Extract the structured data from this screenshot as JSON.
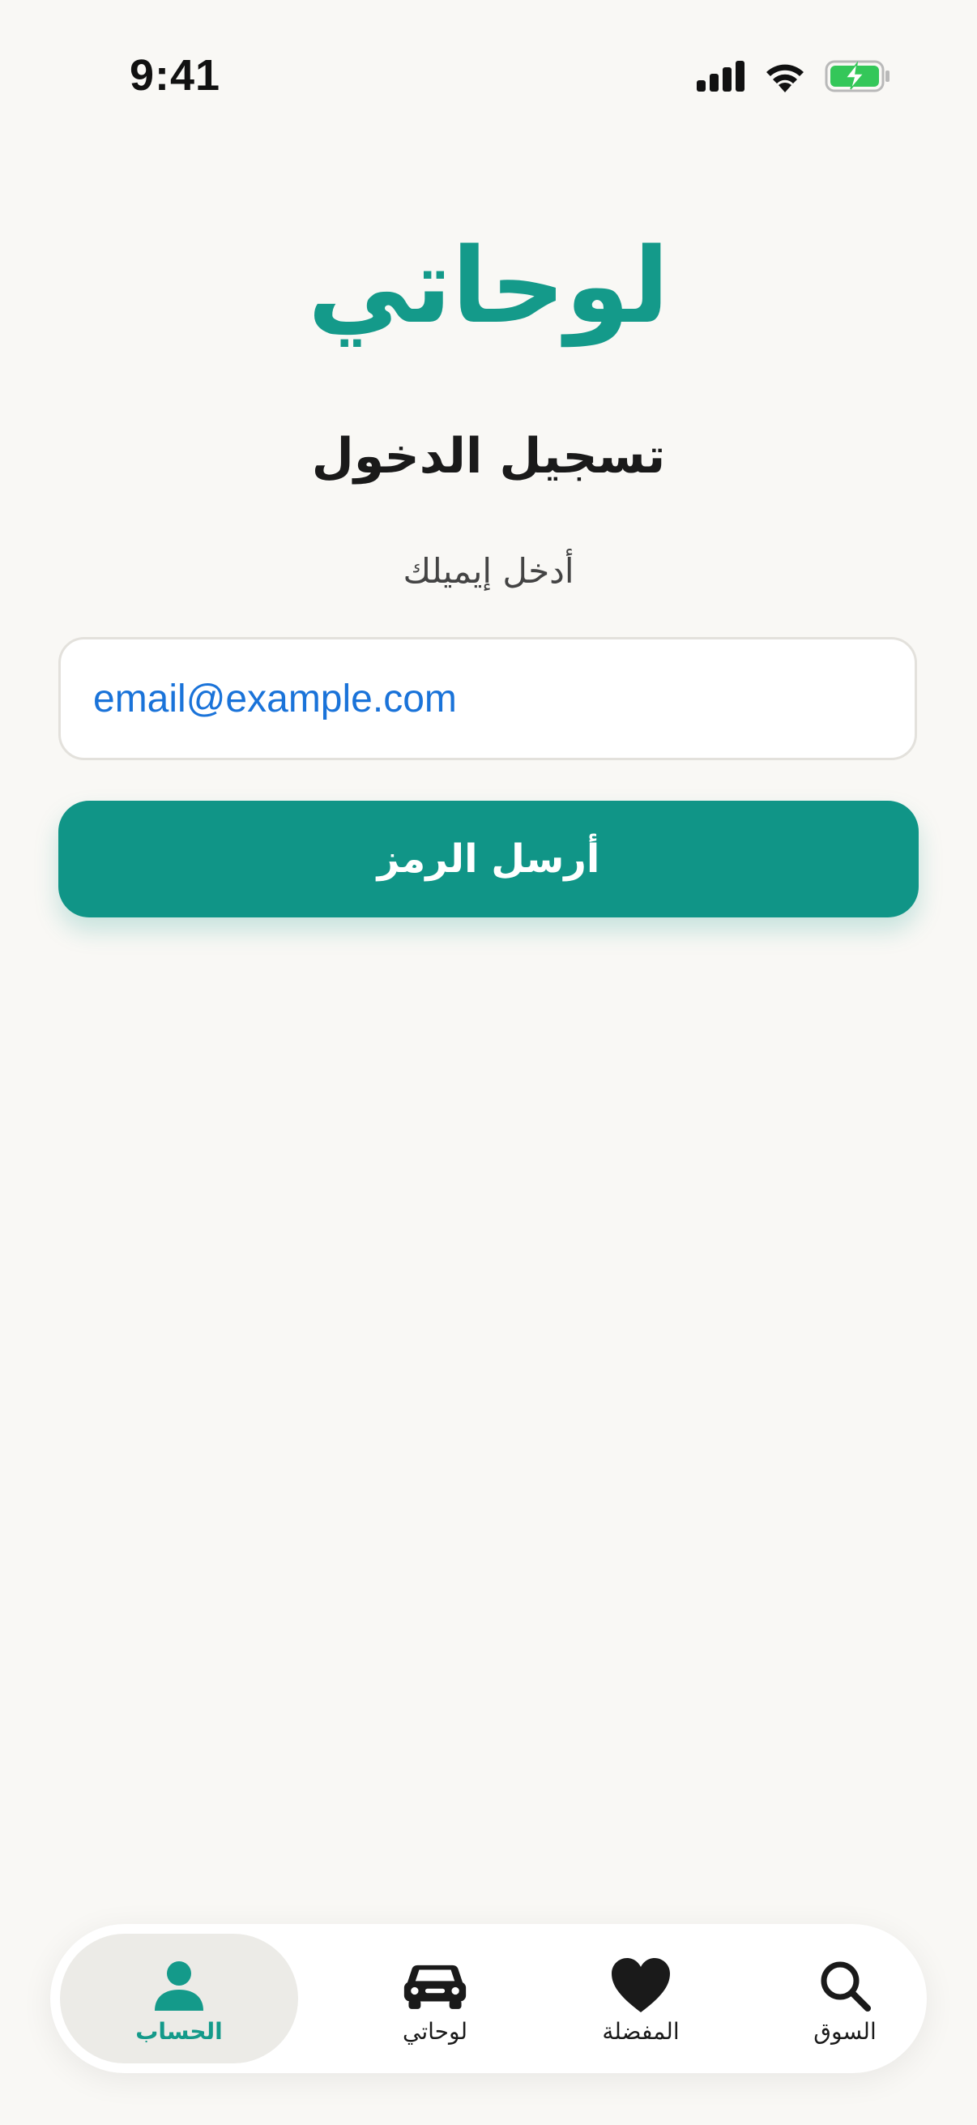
{
  "status_bar": {
    "time": "9:41",
    "signal_icon": "cellular-signal-icon",
    "wifi_icon": "wifi-icon",
    "battery_icon": "battery-charging-icon",
    "battery_color": "#34c759"
  },
  "app": {
    "logo": "لوحاتي",
    "accent_color": "#149a8a"
  },
  "login": {
    "title": "تسجيل الدخول",
    "email_label": "أدخل إيميلك",
    "email_placeholder": "email@example.com",
    "send_button": "أرسل الرمز"
  },
  "tabs": [
    {
      "label": "السوق",
      "icon": "search-icon",
      "active": false
    },
    {
      "label": "المفضلة",
      "icon": "heart-icon",
      "active": false
    },
    {
      "label": "لوحاتي",
      "icon": "car-icon",
      "active": false
    },
    {
      "label": "الحساب",
      "icon": "person-icon",
      "active": true
    }
  ]
}
